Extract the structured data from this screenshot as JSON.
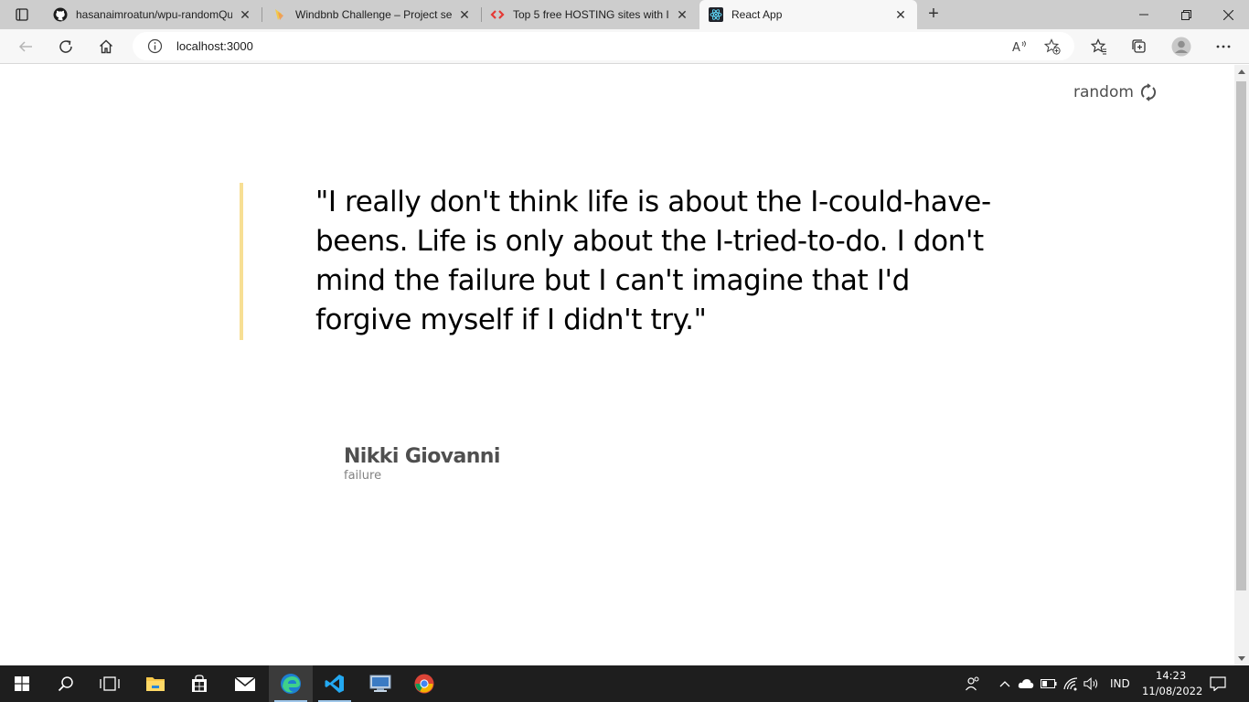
{
  "browser": {
    "tabs": [
      {
        "title": "hasanaimroatun/wpu-randomQu",
        "icon": "github-icon"
      },
      {
        "title": "Windbnb Challenge – Project set",
        "icon": "devchallenges-icon"
      },
      {
        "title": "Top 5 free HOSTING sites with In",
        "icon": "code-brackets-icon"
      },
      {
        "title": "React App",
        "icon": "react-icon",
        "active": true
      }
    ],
    "url": "localhost:3000"
  },
  "page": {
    "random_label": "random",
    "quote": "\"I really don't think life is about the I-could-have-beens. Life is only about the I-tried-to-do. I don't mind the failure but I can't imagine that I'd forgive myself if I didn't try.\"",
    "author": "Nikki Giovanni",
    "genre": "failure",
    "accent_color": "#f7df94"
  },
  "taskbar": {
    "apps": [
      "start-icon",
      "search-icon",
      "task-view-icon",
      "file-explorer-icon",
      "store-icon",
      "mail-icon",
      "edge-icon",
      "vscode-icon",
      "remote-desktop-icon",
      "chrome-icon"
    ],
    "language": "IND",
    "time": "14:23",
    "date": "11/08/2022"
  }
}
